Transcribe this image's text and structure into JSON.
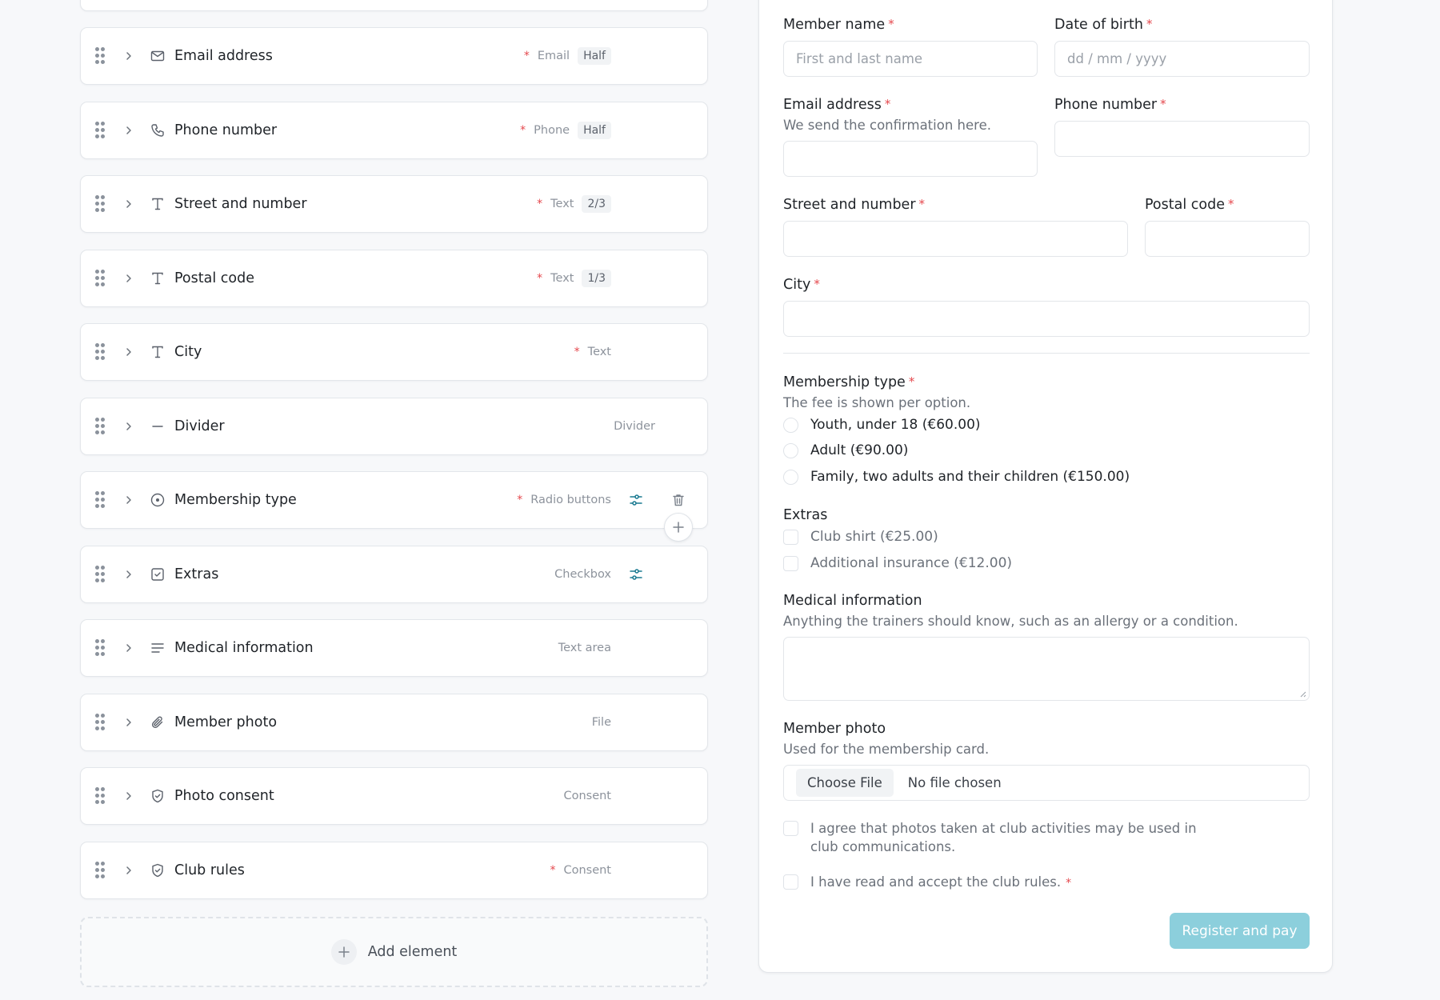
{
  "builder": {
    "rows": [
      {
        "label": "Email address",
        "icon": "mail-icon",
        "required": true,
        "type": "Email",
        "width": "Half"
      },
      {
        "label": "Phone number",
        "icon": "phone-icon",
        "required": true,
        "type": "Phone",
        "width": "Half"
      },
      {
        "label": "Street and number",
        "icon": "text-icon",
        "required": true,
        "type": "Text",
        "width": "2/3"
      },
      {
        "label": "Postal code",
        "icon": "text-icon",
        "required": true,
        "type": "Text",
        "width": "1/3"
      },
      {
        "label": "City",
        "icon": "text-icon",
        "required": true,
        "type": "Text"
      },
      {
        "label": "Divider",
        "icon": "divider-icon",
        "required": false,
        "type": "Divider"
      },
      {
        "label": "Membership type",
        "icon": "radio-icon",
        "required": true,
        "type": "Radio buttons",
        "settings": true,
        "trash": true
      },
      {
        "label": "Extras",
        "icon": "checkbox-icon",
        "required": false,
        "type": "Checkbox",
        "settings": true
      },
      {
        "label": "Medical information",
        "icon": "textarea-icon",
        "required": false,
        "type": "Text area"
      },
      {
        "label": "Member photo",
        "icon": "paperclip-icon",
        "required": false,
        "type": "File"
      },
      {
        "label": "Photo consent",
        "icon": "shield-icon",
        "required": false,
        "type": "Consent"
      },
      {
        "label": "Club rules",
        "icon": "shield-icon",
        "required": true,
        "type": "Consent"
      }
    ],
    "add_element_label": "Add element",
    "required_mark": "*"
  },
  "preview": {
    "member_name": {
      "label": "Member name",
      "placeholder": "First and last name"
    },
    "dob": {
      "label": "Date of birth",
      "placeholder": "dd / mm / yyyy"
    },
    "email": {
      "label": "Email address",
      "help": "We send the confirmation here."
    },
    "phone": {
      "label": "Phone number"
    },
    "street": {
      "label": "Street and number"
    },
    "postal": {
      "label": "Postal code"
    },
    "city": {
      "label": "City"
    },
    "membership": {
      "label": "Membership type",
      "help": "The fee is shown per option.",
      "options": [
        "Youth, under 18 (€60.00)",
        "Adult (€90.00)",
        "Family, two adults and their children (€150.00)"
      ]
    },
    "extras": {
      "label": "Extras",
      "options": [
        "Club shirt (€25.00)",
        "Additional insurance (€12.00)"
      ]
    },
    "medical": {
      "label": "Medical information",
      "help": "Anything the trainers should know, such as an allergy or a condition."
    },
    "photo": {
      "label": "Member photo",
      "help": "Used for the membership card.",
      "choose": "Choose File",
      "nofile": "No file chosen"
    },
    "photo_consent": "I agree that photos taken at club activities may be used in club communications.",
    "rules_consent": "I have read and accept the club rules.",
    "submit": "Register and pay",
    "required_mark": "*"
  },
  "colors": {
    "accent": "#8ccfdc",
    "required": "#e5484d",
    "tool": "#1a7a91"
  }
}
